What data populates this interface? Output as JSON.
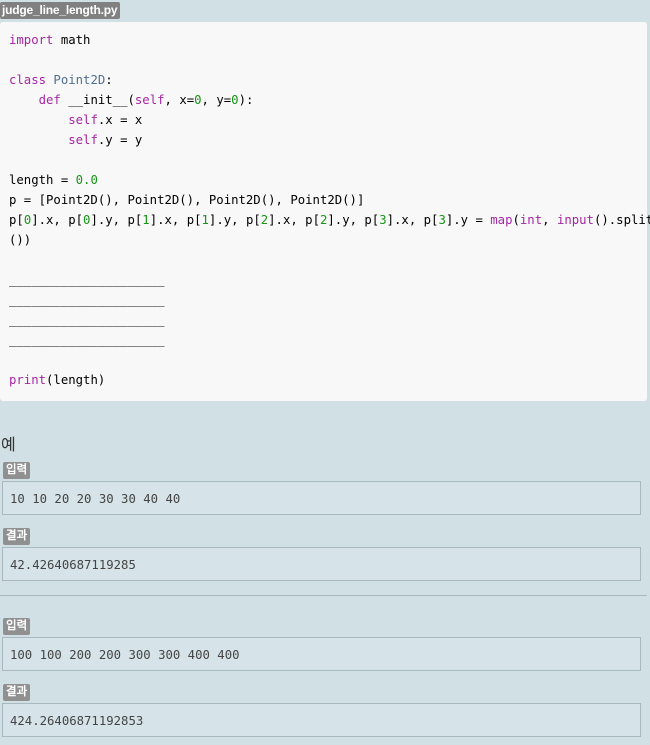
{
  "file": {
    "name": "judge_line_length.py"
  },
  "code": {
    "l1_kw": "import",
    "l1_rest": " math",
    "l3_kw": "class",
    "l3_cls": " Point2D",
    "l3_rest": ":",
    "l4_indent": "    ",
    "l4_kw": "def",
    "l4_rest_a": " __init__(",
    "l4_self": "self",
    "l4_rest_b": ", x=",
    "l4_n1": "0",
    "l4_rest_c": ", y=",
    "l4_n2": "0",
    "l4_rest_d": "):",
    "l5_indent": "        ",
    "l5_self": "self",
    "l5_rest": ".x = x",
    "l6_indent": "        ",
    "l6_self": "self",
    "l6_rest": ".y = y",
    "l8_a": "length = ",
    "l8_num": "0.0",
    "l9": "p = [Point2D(), Point2D(), Point2D(), Point2D()]",
    "l10_a": "p[",
    "l10_n0": "0",
    "l10_b": "].x, p[",
    "l10_n1": "0",
    "l10_c": "].y, p[",
    "l10_n2": "1",
    "l10_d": "].x, p[",
    "l10_n3": "1",
    "l10_e": "].y, p[",
    "l10_n4": "2",
    "l10_f": "].x, p[",
    "l10_n5": "2",
    "l10_g": "].y, p[",
    "l10_n6": "3",
    "l10_h": "].x, p[",
    "l10_n7": "3",
    "l10_i": "].y = ",
    "l10_map": "map",
    "l10_j": "(",
    "l10_int": "int",
    "l10_k": ", ",
    "l10_input": "input",
    "l10_l": "().split",
    "l11": "())",
    "blank1": "_____________________",
    "blank2": "_____________________",
    "blank3": "_____________________",
    "blank4": "_____________________",
    "l18_print": "print",
    "l18_rest": "(length)"
  },
  "examples": {
    "title": "예",
    "items": [
      {
        "input_label": "입력",
        "input_value": "10 10 20 20 30 30 40 40",
        "result_label": "결과",
        "result_value": "42.42640687119285"
      },
      {
        "input_label": "입력",
        "input_value": "100 100 200 200 300 300 400 400",
        "result_label": "결과",
        "result_value": "424.26406871192853"
      }
    ]
  },
  "colors": {
    "page_background": "#d1e0e5",
    "code_background": "#f8f8f8",
    "keyword": "#a626a4",
    "number": "#179517",
    "badge": "#909090"
  }
}
